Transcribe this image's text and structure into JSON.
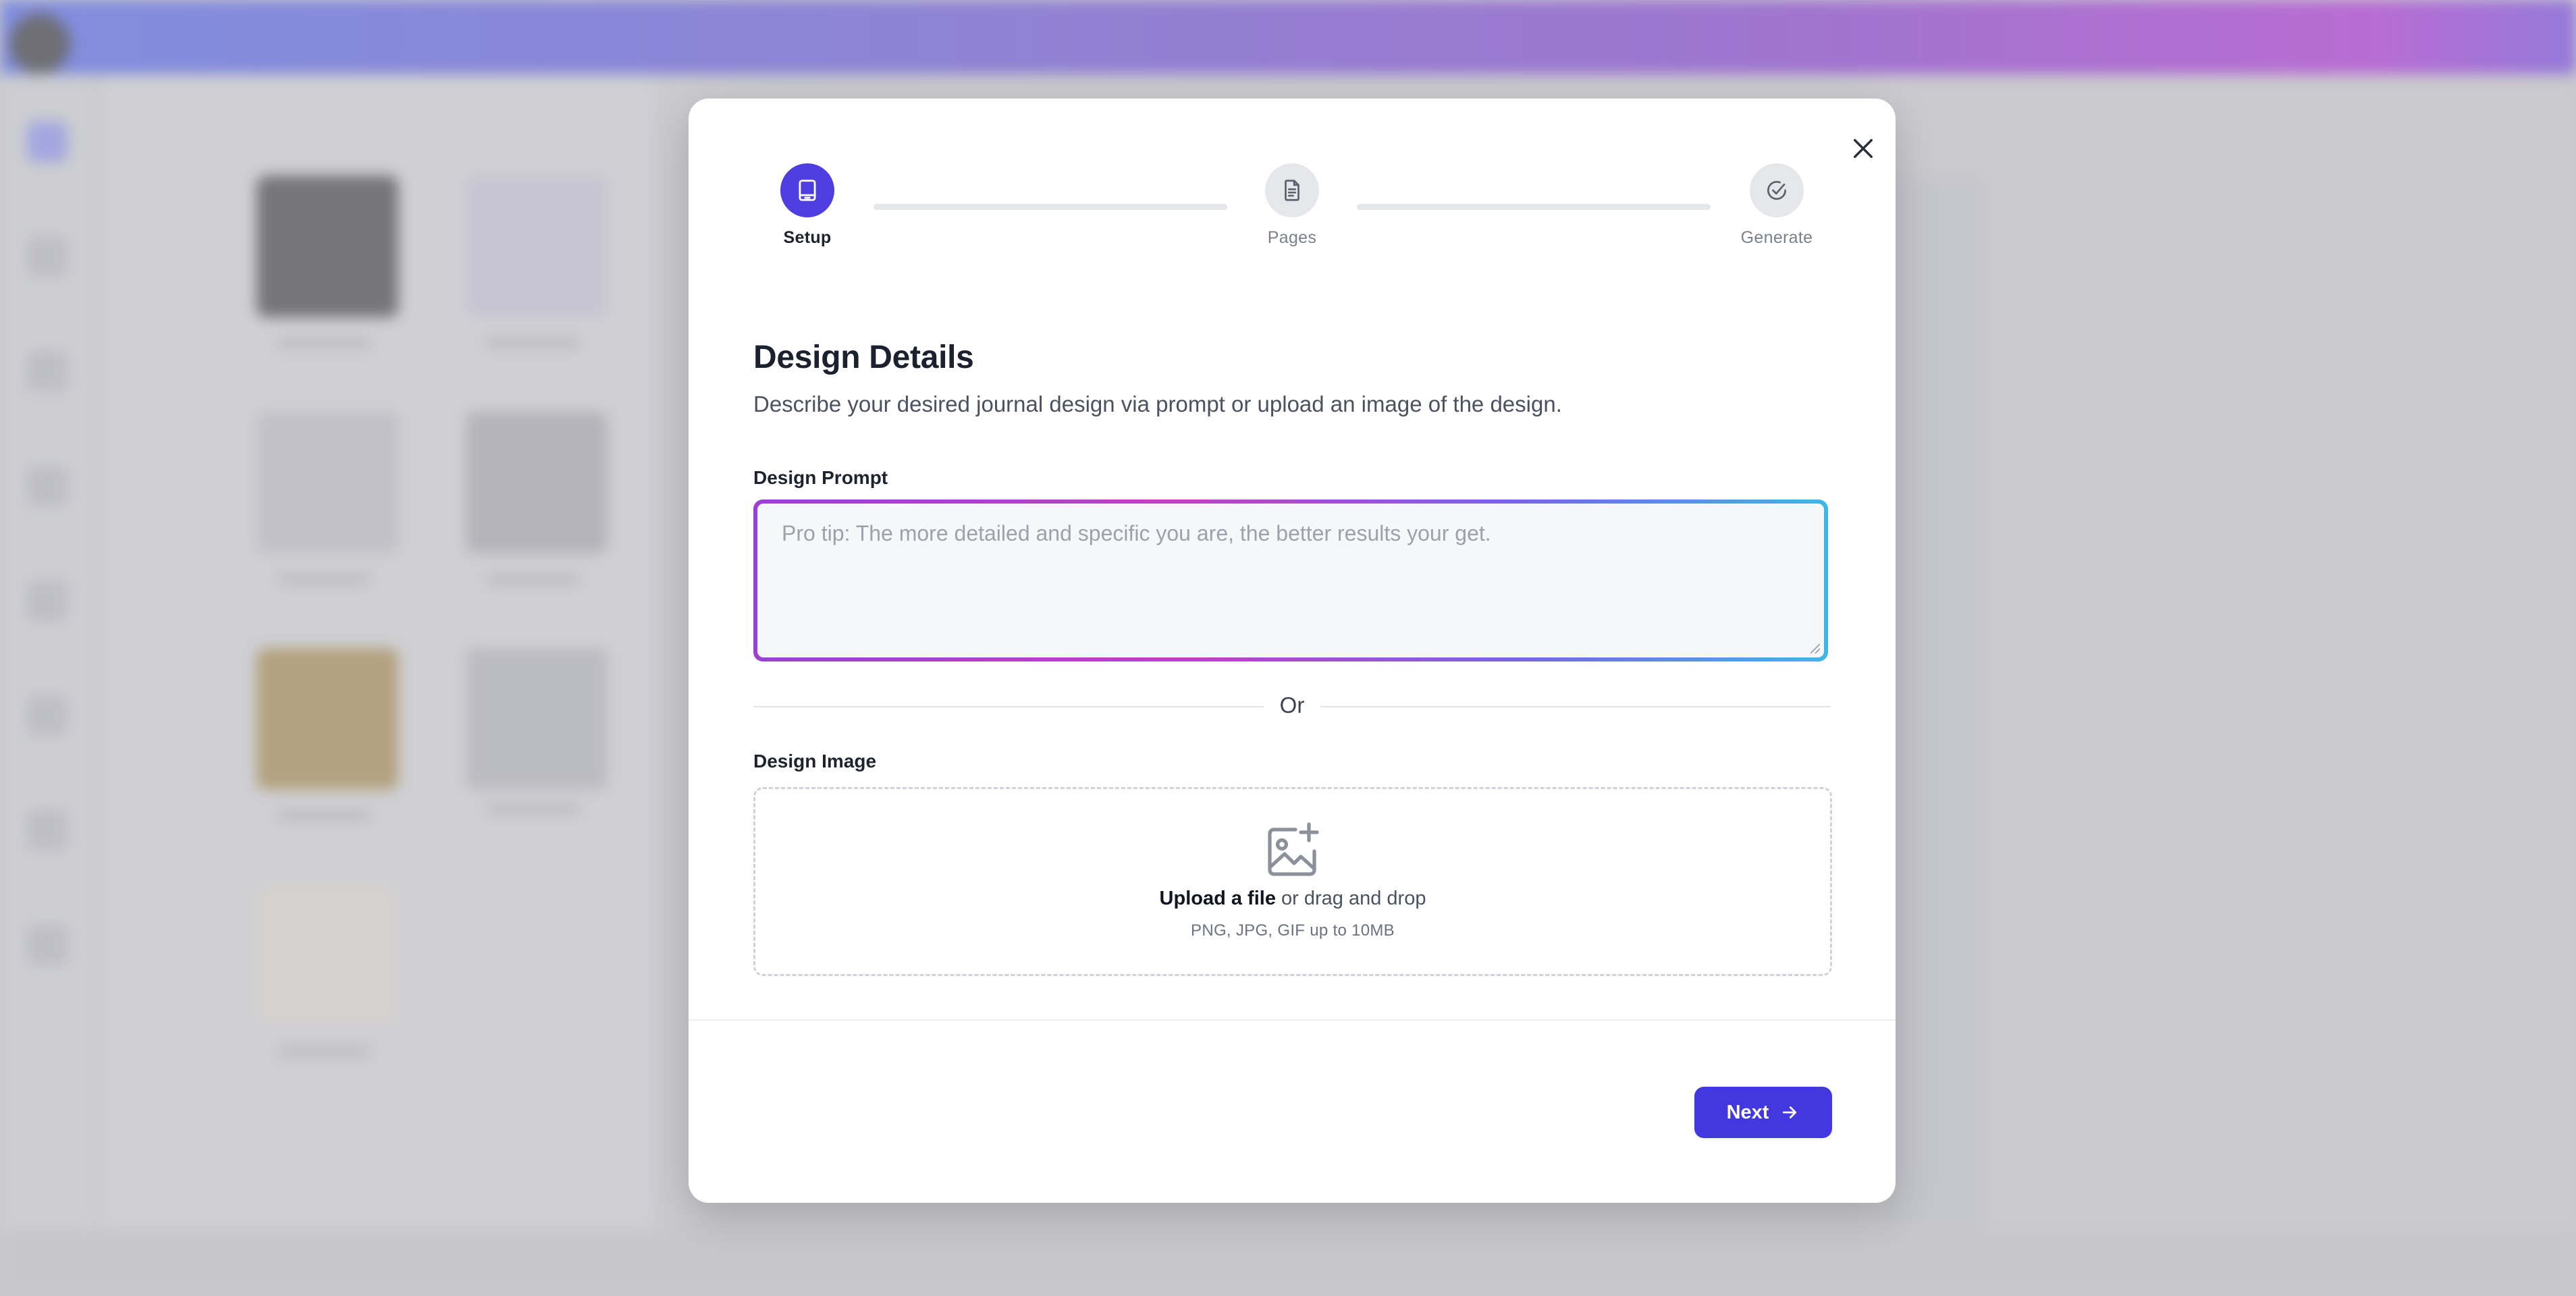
{
  "modal": {
    "steps": [
      {
        "label": "Setup",
        "icon": "book-icon",
        "state": "active"
      },
      {
        "label": "Pages",
        "icon": "document-icon",
        "state": "inactive"
      },
      {
        "label": "Generate",
        "icon": "check-circle-icon",
        "state": "inactive"
      }
    ],
    "title": "Design Details",
    "subtitle": "Describe your desired journal design via prompt or upload an image of the design.",
    "prompt": {
      "label": "Design Prompt",
      "placeholder": "Pro tip: The more detailed and specific you are, the better results your get.",
      "value": ""
    },
    "divider_text": "Or",
    "image": {
      "label": "Design Image",
      "upload_link": "Upload a file",
      "upload_rest": " or drag and drop",
      "hint": "PNG, JPG, GIF up to 10MB"
    },
    "next_label": "Next"
  },
  "colors": {
    "accent": "#4338e0",
    "step_active": "#4f3fe0",
    "step_inactive": "#e6e7ea",
    "prompt_gradient": [
      "#9b3fd6",
      "#c43fc8",
      "#7a62e6",
      "#3fb6e8"
    ]
  }
}
